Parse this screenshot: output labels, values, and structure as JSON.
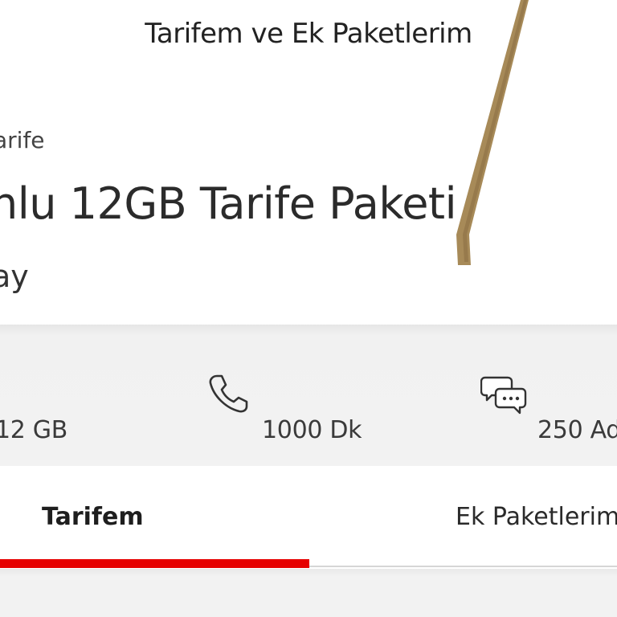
{
  "header": {
    "title": "Tarifem ve Ek Paketlerim"
  },
  "plan": {
    "label": "arife",
    "name": "nlu 12GB Tarife Paketi",
    "period": "ay"
  },
  "allowances": [
    {
      "icon": "data-icon",
      "value": "12 GB"
    },
    {
      "icon": "phone-icon",
      "value": "1000 Dk"
    },
    {
      "icon": "chat-bubbles-icon",
      "value": "250 Ad"
    }
  ],
  "tabs": [
    {
      "label": "Tarifem",
      "active": true
    },
    {
      "label": "Ek Paketlerim",
      "active": false
    }
  ],
  "colors": {
    "accent": "#e60000",
    "panel_background": "#f2f2f2",
    "text": "#333333"
  }
}
